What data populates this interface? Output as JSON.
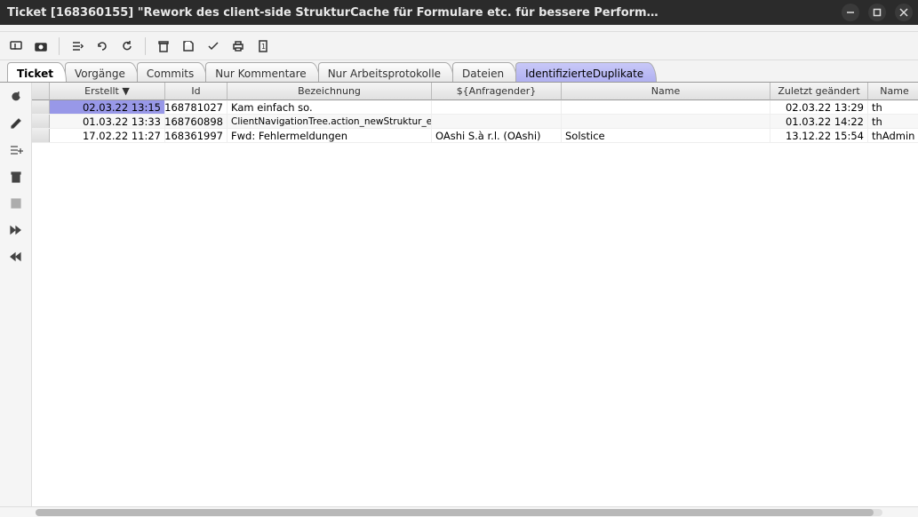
{
  "window": {
    "title": "Ticket [168360155] \"Rework des client-side StrukturCache für Formulare etc. für bessere Perform…"
  },
  "tabs": [
    {
      "label": "Ticket",
      "state": "front"
    },
    {
      "label": "Vorgänge",
      "state": ""
    },
    {
      "label": "Commits",
      "state": ""
    },
    {
      "label": "Nur Kommentare",
      "state": ""
    },
    {
      "label": "Nur Arbeitsprotokolle",
      "state": ""
    },
    {
      "label": "Dateien",
      "state": ""
    },
    {
      "label": "IdentifizierteDuplikate",
      "state": "active"
    }
  ],
  "columns": {
    "erstellt": "Erstellt ▼",
    "id": "Id",
    "bezeichnung": "Bezeichnung",
    "anfragender": "${Anfragender}",
    "name1": "Name",
    "geandert": "Zuletzt geändert",
    "name2": "Name"
  },
  "rows": [
    {
      "erstellt": "02.03.22 13:15",
      "id": "168781027",
      "bez": "Kam einfach so.",
      "anf": "",
      "name1": "",
      "geandert": "02.03.22 13:29",
      "name2": "th",
      "selected": true,
      "small": false
    },
    {
      "erstellt": "01.03.22 13:33",
      "id": "168760898",
      "bez": "ClientNavigationTree.action_newStruktur_enab…",
      "anf": "",
      "name1": "",
      "geandert": "01.03.22 14:22",
      "name2": "th",
      "selected": false,
      "small": true
    },
    {
      "erstellt": "17.02.22 11:27",
      "id": "168361997",
      "bez": "Fwd: Fehlermeldungen",
      "anf": "OAshi S.à r.l. (OAshi)",
      "name1": "Solstice",
      "geandert": "13.12.22 15:54",
      "name2": "thAdmin",
      "selected": false,
      "small": false
    }
  ]
}
